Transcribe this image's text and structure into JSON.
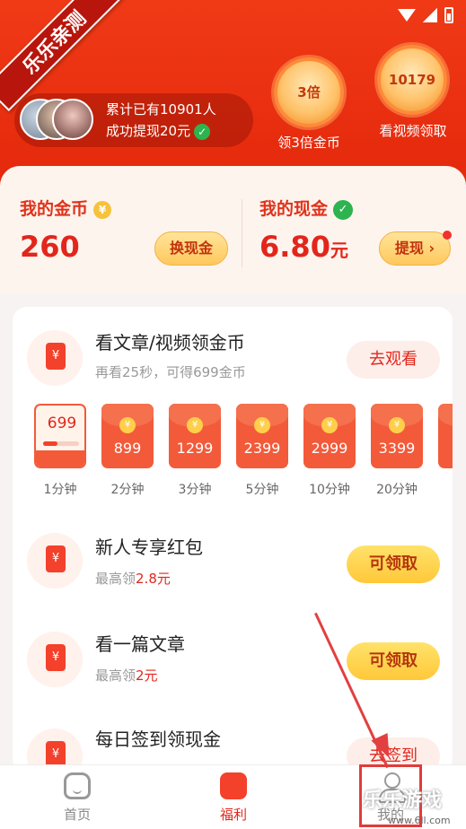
{
  "header": {
    "ribbon": "乐乐亲测",
    "promo_line1": "累计已有10901人",
    "promo_line2": "成功提现20元",
    "badge_left": {
      "value": "3倍",
      "caption": "领3倍金币"
    },
    "badge_right": {
      "value": "10179",
      "caption": "看视频领取"
    }
  },
  "wallet": {
    "coins_label": "我的金币",
    "coins_value": "260",
    "exchange_btn": "换现金",
    "cash_label": "我的现金",
    "cash_value": "6.80",
    "cash_unit": "元",
    "withdraw_btn": "提现 ›"
  },
  "tasks": {
    "watch": {
      "title": "看文章/视频领金币",
      "subtitle": "再看25秒，可得699金币",
      "button": "去观看",
      "progress_fraction": 0.4
    },
    "packets": [
      {
        "amount": "699",
        "label": "1分钟"
      },
      {
        "amount": "899",
        "label": "2分钟"
      },
      {
        "amount": "1299",
        "label": "3分钟"
      },
      {
        "amount": "2399",
        "label": "5分钟"
      },
      {
        "amount": "2999",
        "label": "10分钟"
      },
      {
        "amount": "3399",
        "label": "20分钟"
      },
      {
        "amount": "",
        "label": "4"
      }
    ],
    "newbie": {
      "title": "新人专享红包",
      "sub_prefix": "最高领",
      "sub_value": "2.8元",
      "button": "可领取"
    },
    "article": {
      "title": "看一篇文章",
      "sub_prefix": "最高领",
      "sub_value": "2元",
      "button": "可领取"
    },
    "checkin": {
      "title": "每日签到领现金",
      "button": "去签到"
    }
  },
  "nav": {
    "home": "首页",
    "welfare": "福利",
    "mine": "我的"
  },
  "watermark": {
    "text": "乐乐游戏",
    "sub": "www.6ll.com"
  },
  "colors": {
    "primary_red": "#e4280c",
    "accent_gold": "#ffc85c"
  },
  "icons": {
    "yuan": "¥",
    "check": "✓"
  }
}
